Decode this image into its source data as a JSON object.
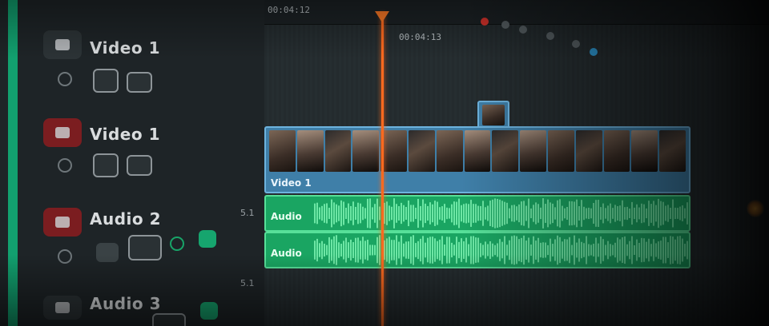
{
  "ruler": {
    "timecode_current": "00:04:12",
    "timecode_next": "00:04:13"
  },
  "tracks": [
    {
      "name": "Video 1",
      "type": "video",
      "locked_color": "#2c3336"
    },
    {
      "name": "Video 1",
      "type": "video",
      "locked_color": "#7b1d20"
    },
    {
      "name": "Audio 2",
      "type": "audio",
      "channel": "5.1"
    },
    {
      "name": "Audio 3",
      "type": "audio",
      "channel": "5.1"
    }
  ],
  "clips": {
    "video_label": "Video 1",
    "audio_label_1": "Audio",
    "audio_label_2": "Audio"
  },
  "colors": {
    "track_accent": "#12a06f",
    "playhead": "#ff6a1f",
    "video_clip": "#3f7fa8",
    "audio_clip": "#1aa562"
  },
  "icons": [
    "video-track-icon",
    "eye-icon",
    "lock-icon",
    "solo-icon",
    "mute-icon",
    "playhead-marker-icon"
  ]
}
